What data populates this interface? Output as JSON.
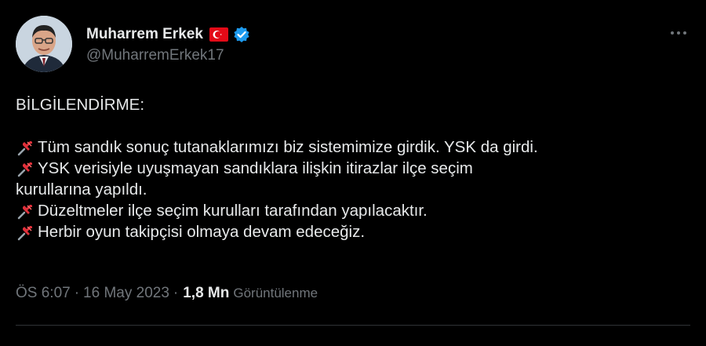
{
  "author": {
    "name": "Muharrem Erkek",
    "handle": "@MuharremErkek17"
  },
  "tweet": {
    "heading": "BİLGİLENDİRME:",
    "lines": [
      "Tüm sandık sonuç tutanaklarımızı biz sistemimize girdik. YSK da girdi.",
      "YSK verisiyle uyuşmayan sandıklara ilişkin itirazlar ilçe seçim",
      "kurullarına yapıldı.",
      "Düzeltmeler ilçe seçim kurulları tarafından yapılacaktır.",
      "Herbir oyun takipçisi olmaya devam edeceğiz."
    ]
  },
  "meta": {
    "time": "ÖS 6:07",
    "separator": "·",
    "date": "16 May 2023",
    "views_count": "1,8 Mn",
    "views_label": "Görüntülenme"
  },
  "icons": {
    "flag": "turkey-flag-icon",
    "verified": "verified-badge-icon",
    "more": "more-options-icon",
    "pin": "pushpin-icon"
  },
  "colors": {
    "background": "#000000",
    "text": "#e7e9ea",
    "secondary": "#71767b",
    "verified": "#1d9bf0",
    "flag": "#e30a17"
  }
}
